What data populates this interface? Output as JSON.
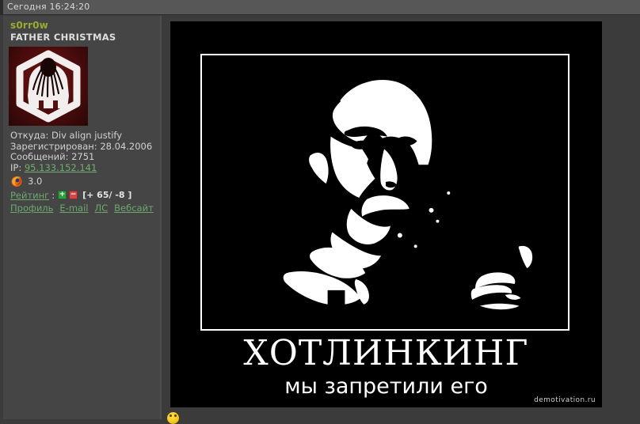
{
  "topbar": {
    "timestamp": "Сегодня 16:24:20"
  },
  "author": {
    "username": "s0rr0w",
    "title": "FATHER CHRISTMAS",
    "avatar_icon": "tentacled-figure-hexagon-icon",
    "avatar_bg_color": "#4a0c0c",
    "location_label": "Откуда:",
    "location_value": "Div align justify",
    "registered_label": "Зарегистрирован:",
    "registered_value": "28.04.2006",
    "posts_label": "Сообщений:",
    "posts_value": "2751",
    "ip_label": "IP:",
    "ip_value": "95.133.152.141",
    "browser_icon": "firefox-icon",
    "browser_version": "3.0",
    "rating_label": "Рейтинг",
    "rating_separator": ":",
    "rating_plus_icon": "plus-icon",
    "rating_minus_icon": "minus-icon",
    "rating_value": "[+ 65/ -8 ]",
    "links": [
      {
        "label": "Профиль",
        "name": "profile-link"
      },
      {
        "label": "E-mail",
        "name": "email-link"
      },
      {
        "label": "ЛС",
        "name": "pm-link"
      },
      {
        "label": "Вебсайт",
        "name": "website-link"
      }
    ],
    "link_color": "#6ea86e",
    "username_color": "#9aab2f"
  },
  "post": {
    "image": {
      "type": "demotivational-poster",
      "background_color": "#000000",
      "frame_color": "#ffffff",
      "photo_description": "high-contrast black and white portrait of Lenin",
      "title": "ХОТЛИНКИНГ",
      "subtitle": "мы запретили его",
      "watermark": "demotivation.ru"
    },
    "smiley_icon": "smiley-icon"
  }
}
